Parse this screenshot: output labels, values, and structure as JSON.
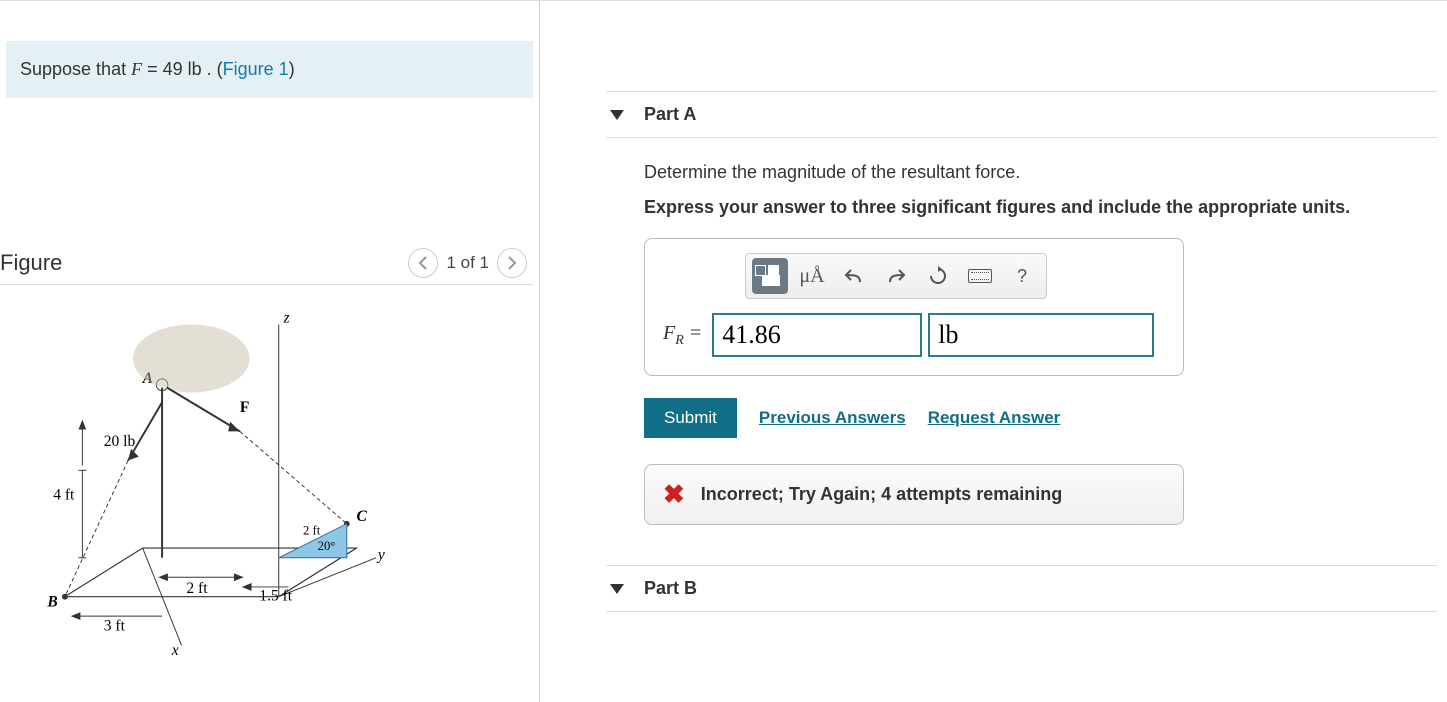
{
  "problem": {
    "prefix": "Suppose that ",
    "var": "F",
    "equals": " = 49 ",
    "unit": "lb",
    "dot": " . (",
    "figref": "Figure 1",
    "close": ")"
  },
  "figure": {
    "title": "Figure",
    "counter": "1 of 1",
    "labels": {
      "A": "A",
      "B": "B",
      "C": "C",
      "F": "F",
      "x": "x",
      "y": "y",
      "z": "z",
      "d4ft": "4 ft",
      "d3ft": "3 ft",
      "d2ft_a": "2 ft",
      "d2ft_b": "2 ft",
      "d15ft": "1.5 ft",
      "ang": "20°",
      "load": "20 lb"
    }
  },
  "partA": {
    "title": "Part A",
    "instruction": "Determine the magnitude of the resultant force.",
    "hint": "Express your answer to three significant figures and include the appropriate units.",
    "toolbar": {
      "units": "μÅ",
      "help": "?"
    },
    "var_html": "F",
    "var_sub": "R",
    "eq": " = ",
    "value": "41.86",
    "unit": "lb",
    "submit": "Submit",
    "prev": "Previous Answers",
    "req": "Request Answer",
    "feedback": "Incorrect; Try Again; 4 attempts remaining"
  },
  "partB": {
    "title": "Part B"
  }
}
